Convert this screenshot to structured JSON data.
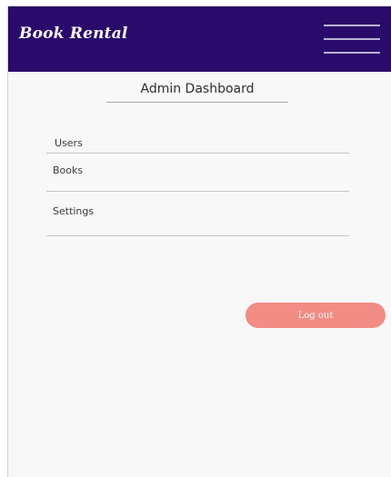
{
  "header": {
    "brand": "Book Rental",
    "menu_icon": "hamburger-menu-icon"
  },
  "main": {
    "title": "Admin Dashboard",
    "nav_items": [
      {
        "label": "Users"
      },
      {
        "label": "Books"
      },
      {
        "label": "Settings"
      }
    ],
    "logout_label": "Log out"
  },
  "colors": {
    "header_bg": "#2a0a6b",
    "logout_bg": "#f28c84",
    "page_bg": "#f8f8f8"
  }
}
